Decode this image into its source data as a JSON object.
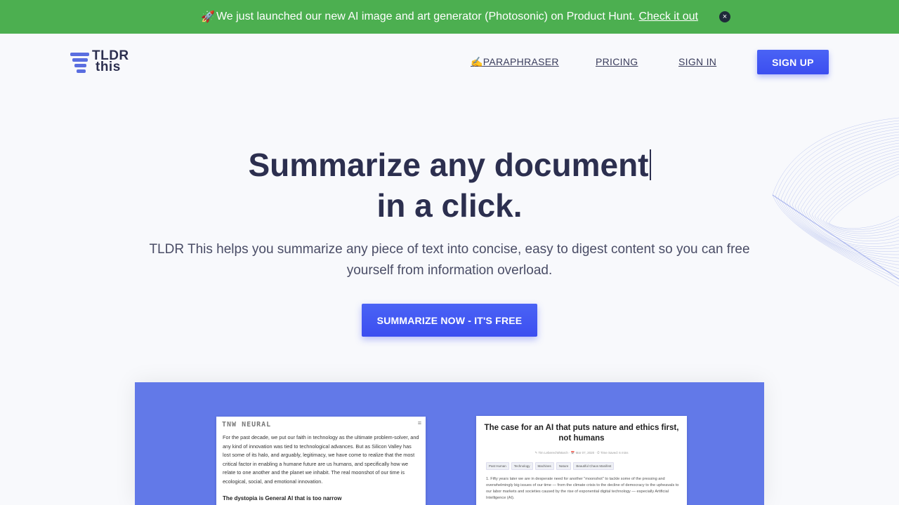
{
  "banner": {
    "rocket": "🚀",
    "text": "We just launched our new AI image and art generator (Photosonic) on Product Hunt.",
    "link": "Check it out",
    "close": "×"
  },
  "logo": {
    "line1": "TLDR",
    "line2": "this"
  },
  "nav": {
    "paraphraser_icon": "✍️",
    "paraphraser": "PARAPHRASER",
    "pricing": "PRICING",
    "sign_in": "SIGN IN",
    "sign_up": "SIGN UP"
  },
  "hero": {
    "title_line1": "Summarize any document",
    "title_line2": "in a click.",
    "subtitle": "TLDR This helps you summarize any piece of text into concise, easy to digest content so you can free yourself from information overload.",
    "cta": "SUMMARIZE NOW - IT'S FREE"
  },
  "demo": {
    "left_card": {
      "brand": "TNW NEURAL",
      "menu": "≡",
      "body": "For the past decade, we put our faith in technology as the ultimate problem-solver, and any kind of innovation was tied to technological advances. But as Silicon Valley has lost some of its halo, and arguably, legitimacy, we have come to realize that the most critical factor in enabling a humane future are us humans, and specifically how we relate to one another and the planet we inhabit. The real moonshot of our time is ecological, social, and emotional innovation.",
      "heading": "The dystopia is General AI that is too narrow"
    },
    "right_card": {
      "title": "The case for an AI that puts nature and ethics first, not humans",
      "meta": "✎ Tim Leberecht/March  ·  📅 Mar 07, 2020  ·  ⏱ Time Saved: 6 mins",
      "tags": [
        "Past Human",
        "Technology",
        "Machines",
        "Nature",
        "Beautiful Chaos Manifest"
      ],
      "list_item": "1. Fifty years later we are in desperate need for another \"moonshot\" to tackle some of the pressing and overwhelmingly big issues of our time — from the climate crisis to the decline of democracy to the upheavals to our labor markets and societies caused by the rise of exponential digital technology — especially Artificial Intelligence (AI)."
    }
  }
}
